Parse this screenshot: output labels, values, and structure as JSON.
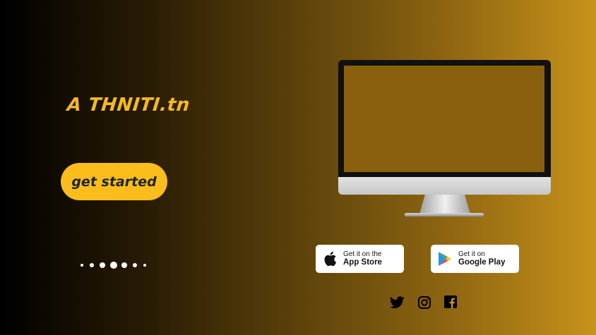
{
  "brand": {
    "logo_text": "A THNITI.tn"
  },
  "hero": {
    "cta_label": "get started"
  },
  "carousel": {
    "dot_count": 7,
    "active_index": 3
  },
  "stores": [
    {
      "small": "Get it on the",
      "big": "App Store",
      "icon": "apple-icon"
    },
    {
      "small": "Get it on",
      "big": "Google Play",
      "icon": "google-play-icon"
    }
  ],
  "social": [
    {
      "icon": "twitter-icon"
    },
    {
      "icon": "instagram-icon"
    },
    {
      "icon": "facebook-icon"
    }
  ],
  "colors": {
    "accent": "#fbbd1b",
    "logo": "#f5b91f",
    "gradient_start": "#000000",
    "gradient_end": "#c8931b"
  }
}
